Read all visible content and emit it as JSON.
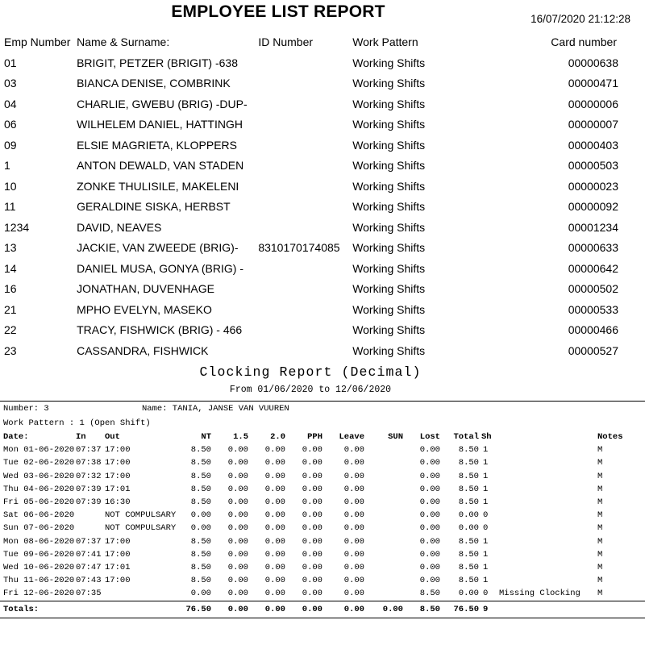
{
  "employee_report": {
    "title": "EMPLOYEE LIST REPORT",
    "datetime": "16/07/2020 21:12:28",
    "columns": {
      "emp_number": "Emp Number",
      "name_surname": "Name & Surname:",
      "id_number": "ID Number",
      "work_pattern": "Work Pattern",
      "card_number": "Card number"
    },
    "rows": [
      {
        "emp_number": "01",
        "name": "BRIGIT, PETZER  (BRIGIT) -638",
        "id_number": "",
        "work_pattern": "Working Shifts",
        "card_number": "00000638"
      },
      {
        "emp_number": "03",
        "name": "BIANCA DENISE, COMBRINK",
        "id_number": "",
        "work_pattern": "Working Shifts",
        "card_number": "00000471"
      },
      {
        "emp_number": "04",
        "name": "CHARLIE, GWEBU (BRIG) -DUP-",
        "id_number": "",
        "work_pattern": "Working Shifts",
        "card_number": "00000006"
      },
      {
        "emp_number": "06",
        "name": "WILHELEM DANIEL, HATTINGH",
        "id_number": "",
        "work_pattern": "Working Shifts",
        "card_number": "00000007"
      },
      {
        "emp_number": "09",
        "name": "ELSIE MAGRIETA, KLOPPERS",
        "id_number": "",
        "work_pattern": "Working Shifts",
        "card_number": "00000403"
      },
      {
        "emp_number": "1",
        "name": "ANTON DEWALD, VAN STADEN",
        "id_number": "",
        "work_pattern": "Working Shifts",
        "card_number": "00000503"
      },
      {
        "emp_number": "10",
        "name": "ZONKE THULISILE, MAKELENI",
        "id_number": "",
        "work_pattern": "Working Shifts",
        "card_number": "00000023"
      },
      {
        "emp_number": "11",
        "name": "GERALDINE SISKA, HERBST",
        "id_number": "",
        "work_pattern": "Working Shifts",
        "card_number": "00000092"
      },
      {
        "emp_number": "1234",
        "name": "DAVID, NEAVES",
        "id_number": "",
        "work_pattern": "Working Shifts",
        "card_number": "00001234"
      },
      {
        "emp_number": "13",
        "name": "JACKIE, VAN ZWEEDE  (BRIG)-",
        "id_number": "8310170174085",
        "work_pattern": "Working Shifts",
        "card_number": "00000633"
      },
      {
        "emp_number": "14",
        "name": "DANIEL MUSA, GONYA  (BRIG) -",
        "id_number": "",
        "work_pattern": "Working Shifts",
        "card_number": "00000642"
      },
      {
        "emp_number": "16",
        "name": "JONATHAN, DUVENHAGE",
        "id_number": "",
        "work_pattern": "Working Shifts",
        "card_number": "00000502"
      },
      {
        "emp_number": "21",
        "name": "MPHO EVELYN, MASEKO",
        "id_number": "",
        "work_pattern": "Working Shifts",
        "card_number": "00000533"
      },
      {
        "emp_number": "22",
        "name": "TRACY, FISHWICK  (BRIG) - 466",
        "id_number": "",
        "work_pattern": "Working Shifts",
        "card_number": "00000466"
      },
      {
        "emp_number": "23",
        "name": "CASSANDRA, FISHWICK",
        "id_number": "",
        "work_pattern": "Working Shifts",
        "card_number": "00000527"
      }
    ]
  },
  "clocking_report": {
    "title": "Clocking Report  (Decimal)",
    "subtitle": "From 01/06/2020 to 12/06/2020",
    "meta": {
      "number_label": "Number:  3",
      "name_label": "Name: TANIA, JANSE VAN VUUREN",
      "work_pattern_label": "Work Pattern :  1 (Open Shift)"
    },
    "columns": {
      "date": "Date:",
      "in": "In",
      "out": "Out",
      "nt": "NT",
      "ot15": "1.5",
      "ot20": "2.0",
      "pph": "PPH",
      "leave": "Leave",
      "sun": "SUN",
      "lost": "Lost",
      "total": "Total",
      "sh": "Sh",
      "notes": "Notes"
    },
    "rows": [
      {
        "date": "Mon 01-06-2020",
        "in": "07:37",
        "out": "17:00",
        "nt": "8.50",
        "ot15": "0.00",
        "ot20": "0.00",
        "pph": "0.00",
        "leave": "0.00",
        "sun": "",
        "lost": "0.00",
        "total": "8.50",
        "sh": "1",
        "remark": "",
        "notes": "M"
      },
      {
        "date": "Tue 02-06-2020",
        "in": "07:38",
        "out": "17:00",
        "nt": "8.50",
        "ot15": "0.00",
        "ot20": "0.00",
        "pph": "0.00",
        "leave": "0.00",
        "sun": "",
        "lost": "0.00",
        "total": "8.50",
        "sh": "1",
        "remark": "",
        "notes": "M"
      },
      {
        "date": "Wed 03-06-2020",
        "in": "07:32",
        "out": "17:00",
        "nt": "8.50",
        "ot15": "0.00",
        "ot20": "0.00",
        "pph": "0.00",
        "leave": "0.00",
        "sun": "",
        "lost": "0.00",
        "total": "8.50",
        "sh": "1",
        "remark": "",
        "notes": "M"
      },
      {
        "date": "Thu 04-06-2020",
        "in": "07:39",
        "out": "17:01",
        "nt": "8.50",
        "ot15": "0.00",
        "ot20": "0.00",
        "pph": "0.00",
        "leave": "0.00",
        "sun": "",
        "lost": "0.00",
        "total": "8.50",
        "sh": "1",
        "remark": "",
        "notes": "M"
      },
      {
        "date": "Fri 05-06-2020",
        "in": "07:39",
        "out": "16:30",
        "nt": "8.50",
        "ot15": "0.00",
        "ot20": "0.00",
        "pph": "0.00",
        "leave": "0.00",
        "sun": "",
        "lost": "0.00",
        "total": "8.50",
        "sh": "1",
        "remark": "",
        "notes": "M"
      },
      {
        "date": "Sat 06-06-2020",
        "in": "",
        "out": "NOT COMPULSARY",
        "nt": "0.00",
        "ot15": "0.00",
        "ot20": "0.00",
        "pph": "0.00",
        "leave": "0.00",
        "sun": "",
        "lost": "0.00",
        "total": "0.00",
        "sh": "0",
        "remark": "",
        "notes": "M"
      },
      {
        "date": "Sun 07-06-2020",
        "in": "",
        "out": "NOT COMPULSARY",
        "nt": "0.00",
        "ot15": "0.00",
        "ot20": "0.00",
        "pph": "0.00",
        "leave": "0.00",
        "sun": "",
        "lost": "0.00",
        "total": "0.00",
        "sh": "0",
        "remark": "",
        "notes": "M"
      },
      {
        "date": "Mon 08-06-2020",
        "in": "07:37",
        "out": "17:00",
        "nt": "8.50",
        "ot15": "0.00",
        "ot20": "0.00",
        "pph": "0.00",
        "leave": "0.00",
        "sun": "",
        "lost": "0.00",
        "total": "8.50",
        "sh": "1",
        "remark": "",
        "notes": "M"
      },
      {
        "date": "Tue 09-06-2020",
        "in": "07:41",
        "out": "17:00",
        "nt": "8.50",
        "ot15": "0.00",
        "ot20": "0.00",
        "pph": "0.00",
        "leave": "0.00",
        "sun": "",
        "lost": "0.00",
        "total": "8.50",
        "sh": "1",
        "remark": "",
        "notes": "M"
      },
      {
        "date": "Wed 10-06-2020",
        "in": "07:47",
        "out": "17:01",
        "nt": "8.50",
        "ot15": "0.00",
        "ot20": "0.00",
        "pph": "0.00",
        "leave": "0.00",
        "sun": "",
        "lost": "0.00",
        "total": "8.50",
        "sh": "1",
        "remark": "",
        "notes": "M"
      },
      {
        "date": "Thu 11-06-2020",
        "in": "07:43",
        "out": "17:00",
        "nt": "8.50",
        "ot15": "0.00",
        "ot20": "0.00",
        "pph": "0.00",
        "leave": "0.00",
        "sun": "",
        "lost": "0.00",
        "total": "8.50",
        "sh": "1",
        "remark": "",
        "notes": "M"
      },
      {
        "date": "Fri 12-06-2020",
        "in": "07:35",
        "out": "",
        "nt": "0.00",
        "ot15": "0.00",
        "ot20": "0.00",
        "pph": "0.00",
        "leave": "0.00",
        "sun": "",
        "lost": "8.50",
        "total": "0.00",
        "sh": "0",
        "remark": "Missing Clocking",
        "notes": "M"
      }
    ],
    "totals": {
      "label": "Totals:",
      "nt": "76.50",
      "ot15": "0.00",
      "ot20": "0.00",
      "pph": "0.00",
      "leave": "0.00",
      "sun": "0.00",
      "lost": "8.50",
      "total": "76.50",
      "sh": "9"
    }
  }
}
